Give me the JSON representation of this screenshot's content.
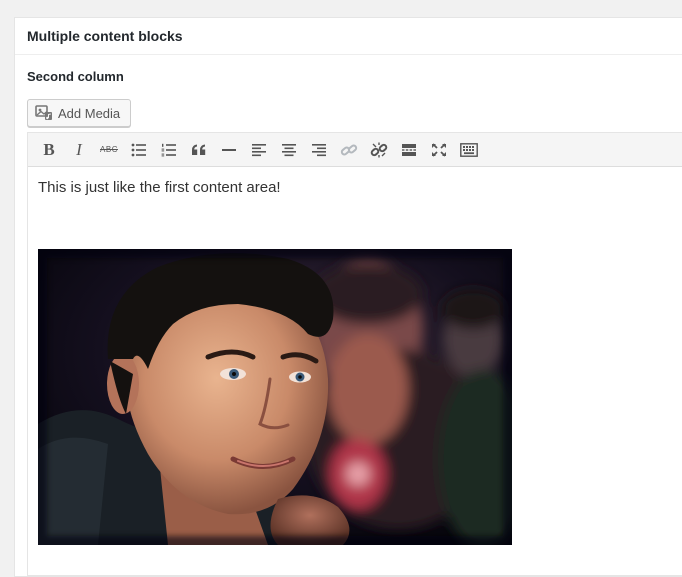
{
  "postbox": {
    "title": "Multiple content blocks"
  },
  "field": {
    "label": "Second column"
  },
  "add_media": {
    "label": "Add Media"
  },
  "toolbar": {
    "bold": "B",
    "italic": "I",
    "strike": "ABC"
  },
  "editor": {
    "content_text": "This is just like the first content area!"
  },
  "icons": [
    "add-media-icon",
    "bold-icon",
    "italic-icon",
    "strikethrough-icon",
    "bullet-list-icon",
    "numbered-list-icon",
    "blockquote-icon",
    "horizontal-rule-icon",
    "align-left-icon",
    "align-center-icon",
    "align-right-icon",
    "insert-link-icon",
    "remove-link-icon",
    "read-more-icon",
    "fullscreen-icon",
    "toolbar-toggle-icon"
  ]
}
